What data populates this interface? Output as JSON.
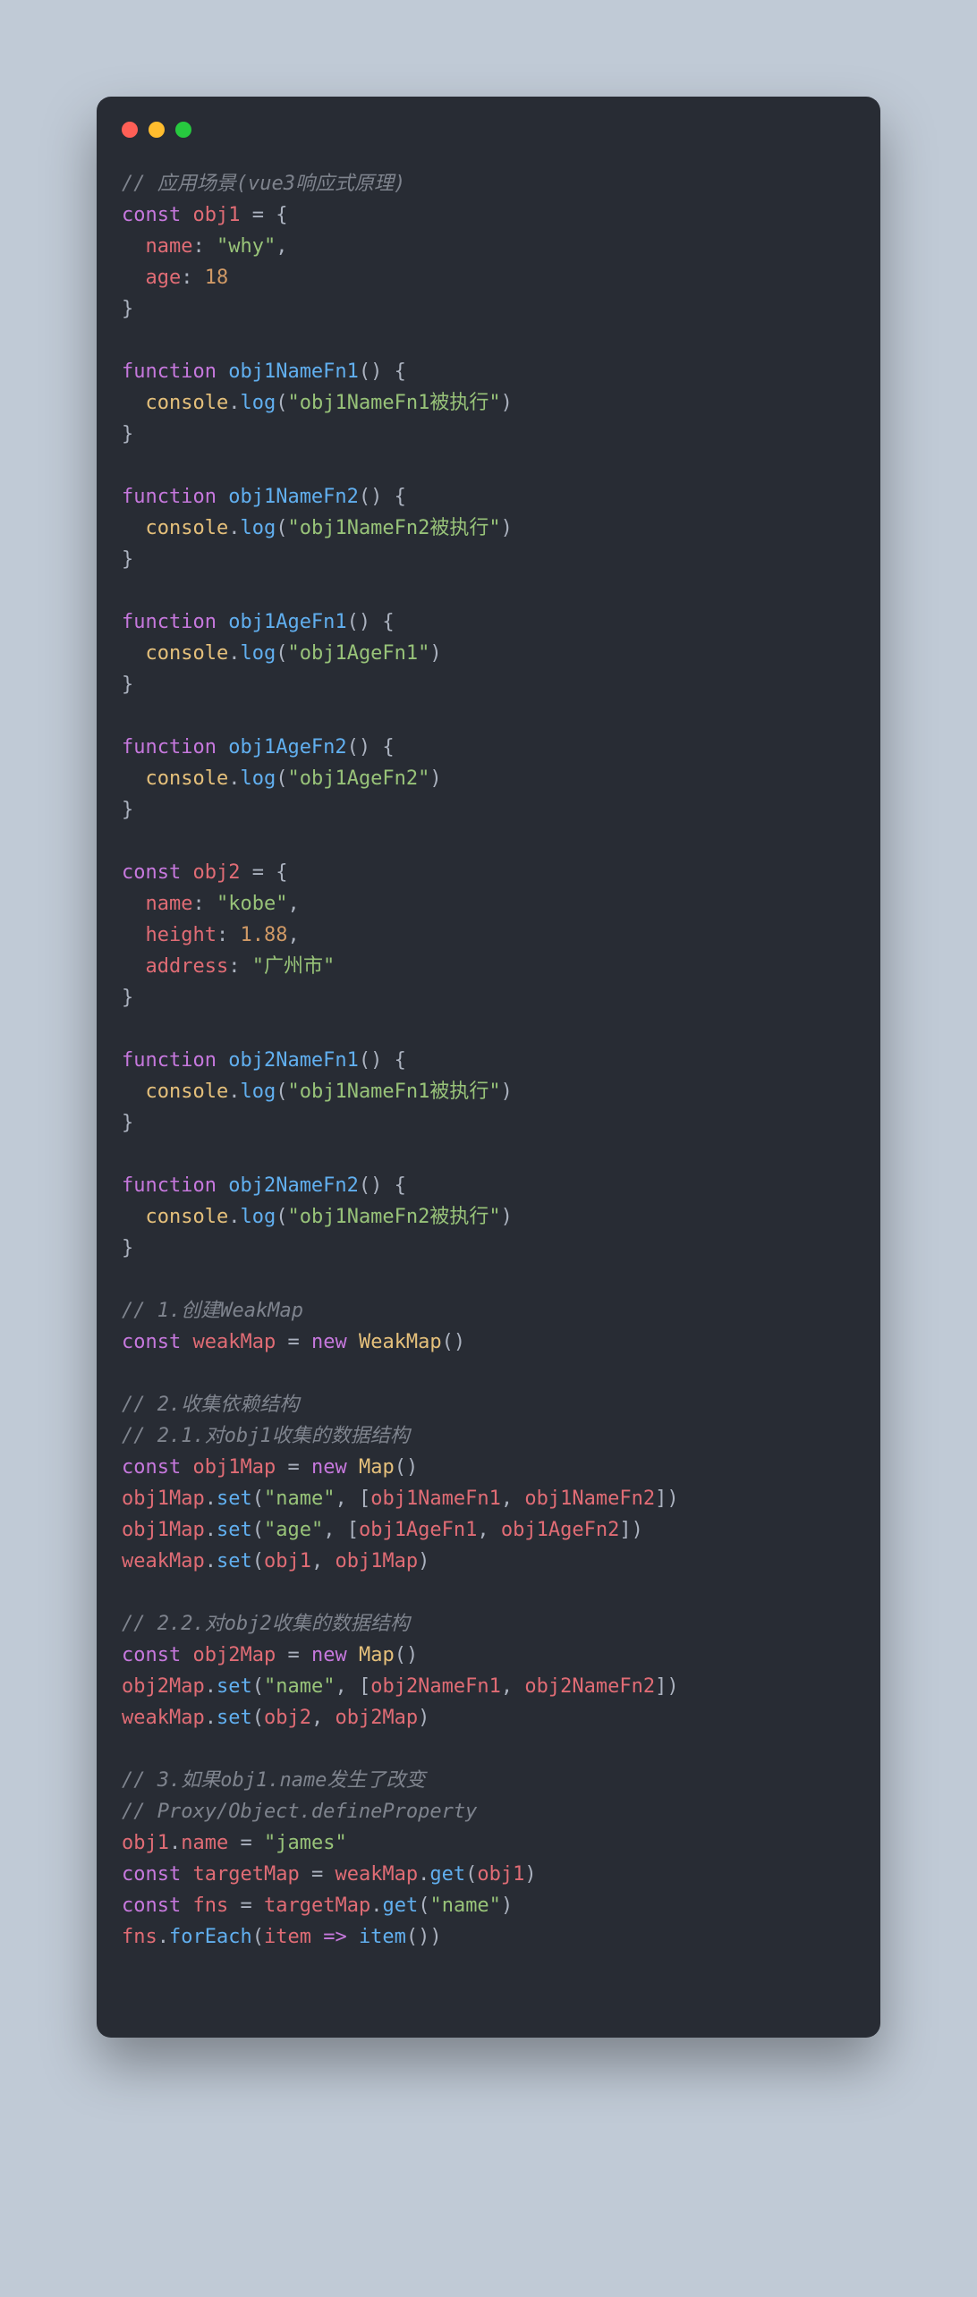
{
  "dots": {
    "red": "#ff5f56",
    "yellow": "#ffbd2e",
    "green": "#27c93f"
  },
  "code": {
    "c1": "// 应用场景(vue3响应式原理)",
    "k_const": "const",
    "obj1": "obj1",
    "eq": " = {",
    "name_k": "name",
    "colon": ": ",
    "why": "\"why\"",
    "comma": ",",
    "age_k": "age",
    "n18": "18",
    "cb": "}",
    "k_fn": "function",
    "fn_obj1NameFn1": "obj1NameFn1",
    "fn_obj1NameFn2": "obj1NameFn2",
    "fn_obj1AgeFn1": "obj1AgeFn1",
    "fn_obj1AgeFn2": "obj1AgeFn2",
    "fn_obj2NameFn1": "obj2NameFn1",
    "fn_obj2NameFn2": "obj2NameFn2",
    "paren_ob": "() {",
    "console": "console",
    "dot": ".",
    "log": "log",
    "op": "(",
    "cp": ")",
    "s_obj1NameFn1": "\"obj1NameFn1被执行\"",
    "s_obj1NameFn2": "\"obj1NameFn2被执行\"",
    "s_obj1AgeFn1": "\"obj1AgeFn1\"",
    "s_obj1AgeFn2": "\"obj1AgeFn2\"",
    "obj2": "obj2",
    "kobe": "\"kobe\"",
    "height_k": "height",
    "n188": "1.88",
    "address_k": "address",
    "gz": "\"广州市\"",
    "c2": "// 1.创建WeakMap",
    "weakMap": "weakMap",
    "k_new": "new",
    "WeakMap": "WeakMap",
    "Map": "Map",
    "c3": "// 2.收集依赖结构",
    "c4": "// 2.1.对obj1收集的数据结构",
    "obj1Map": "obj1Map",
    "set": "set",
    "s_name": "\"name\"",
    "s_age": "\"age\"",
    "obj1NameFn1": "obj1NameFn1",
    "obj1NameFn2": "obj1NameFn2",
    "obj1AgeFn1": "obj1AgeFn1",
    "obj1AgeFn2": "obj1AgeFn2",
    "c5": "// 2.2.对obj2收集的数据结构",
    "obj2Map": "obj2Map",
    "obj2NameFn1": "obj2NameFn1",
    "obj2NameFn2": "obj2NameFn2",
    "c6": "// 3.如果obj1.name发生了改变",
    "c7": "// Proxy/Object.defineProperty",
    "james": "\"james\"",
    "targetMap": "targetMap",
    "get": "get",
    "fns": "fns",
    "forEach": "forEach",
    "item": "item",
    "arrow": " => ",
    "ob": "[",
    "cbk": "]",
    "cs": ", ",
    "sp": " ",
    "eq2": " = "
  }
}
